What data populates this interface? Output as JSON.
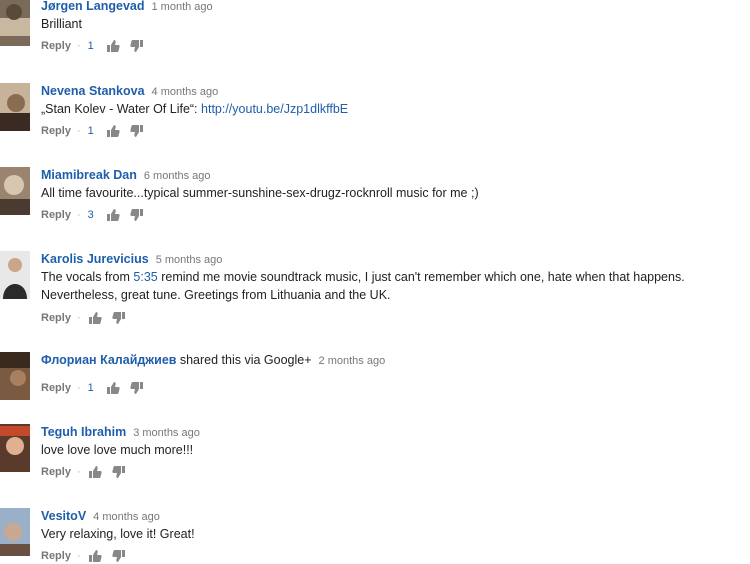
{
  "comments": [
    {
      "author": "Jørgen Langevad",
      "time": "1 month ago",
      "text": "Brilliant",
      "reply": "Reply",
      "likes": "1",
      "avatar_colors": [
        "#7a6a5a",
        "#c8b8a0",
        "#5a4a3a"
      ]
    },
    {
      "author": "Nevena Stankova",
      "time": "4 months ago",
      "text_prefix": "„Stan Kolev - Water Of Life“: ",
      "link": "http://youtu.be/Jzp1dlkffbE",
      "reply": "Reply",
      "likes": "1",
      "avatar_colors": [
        "#c7b39a",
        "#8a6c52",
        "#3b2a22"
      ]
    },
    {
      "author": "Miamibreak Dan",
      "time": "6 months ago",
      "text": "All time favourite...typical summer-sunshine-sex-drugz-rocknroll music for me ;)",
      "reply": "Reply",
      "likes": "3",
      "avatar_colors": [
        "#9a8470",
        "#4a3a30",
        "#d8c6b0"
      ]
    },
    {
      "author": "Karolis Jurevicius",
      "time": "5 months ago",
      "text_prefix": "The vocals from ",
      "link": "5:35",
      "text_suffix": " remind me movie soundtrack music, I just can't remember which one, hate when that happens. Nevertheless, great tune. Greetings from Lithuania and the UK.",
      "reply": "Reply",
      "likes": "",
      "avatar_colors": [
        "#e8e8e8",
        "#2a2a2a",
        "#c9a68a"
      ]
    },
    {
      "author": "Флориан Калайджиев",
      "shared": "shared this via Google+",
      "time": "2 months ago",
      "reply": "Reply",
      "likes": "1",
      "avatar_colors": [
        "#7a5a40",
        "#3a2a1e",
        "#a88060"
      ]
    },
    {
      "author": "Teguh Ibrahim",
      "time": "3 months ago",
      "text": "love love love much more!!!",
      "reply": "Reply",
      "likes": "",
      "avatar_colors": [
        "#c24a2a",
        "#5a3a2a",
        "#e0b090"
      ]
    },
    {
      "author": "VesitoV",
      "time": "4 months ago",
      "text": "Very relaxing, love it! Great!",
      "reply": "Reply",
      "likes": "",
      "avatar_colors": [
        "#9ab0c8",
        "#c8a890",
        "#6a5040"
      ]
    }
  ]
}
